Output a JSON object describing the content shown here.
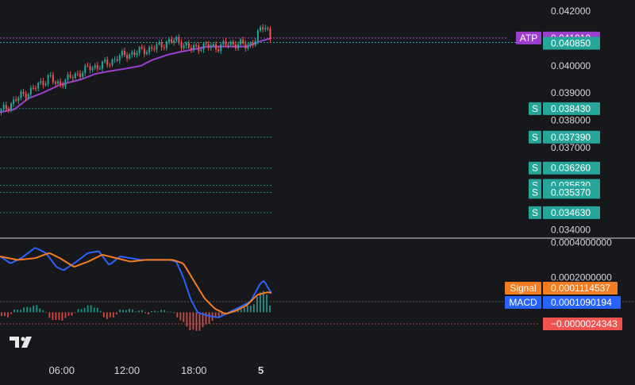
{
  "chart_data": [
    {
      "type": "candlestick",
      "title": "",
      "ylim": [
        0.0337,
        0.0424
      ],
      "price_axis_ticks": [
        "0.042000",
        "0.040000",
        "0.039000",
        "0.038000",
        "0.037000",
        "0.034000"
      ],
      "price_axis_tick_values": [
        0.042,
        0.04,
        0.039,
        0.038,
        0.037,
        0.034
      ],
      "last_price": {
        "value": 0.04085,
        "label": "0.040850"
      },
      "atp": {
        "name": "ATP",
        "value": 0.04101,
        "label": "0.041010",
        "color": "#9c3fce"
      },
      "support_levels": [
        {
          "tag": "S",
          "value": 0.03843,
          "label": "0.038430"
        },
        {
          "tag": "S",
          "value": 0.03739,
          "label": "0.037390"
        },
        {
          "tag": "S",
          "value": 0.03626,
          "label": "0.036260"
        },
        {
          "tag": "S",
          "value": 0.03563,
          "label": "0.035630"
        },
        {
          "tag": "S",
          "value": 0.03537,
          "label": "0.035370"
        },
        {
          "tag": "S",
          "value": 0.03463,
          "label": "0.034630"
        }
      ],
      "atp_line_steps": [
        [
          0,
          0.0383
        ],
        [
          8,
          0.0384
        ],
        [
          16,
          0.0388
        ],
        [
          24,
          0.039
        ],
        [
          34,
          0.0393
        ],
        [
          46,
          0.0395
        ],
        [
          54,
          0.0397
        ],
        [
          62,
          0.0398
        ],
        [
          72,
          0.0399
        ],
        [
          80,
          0.04
        ],
        [
          86,
          0.0402
        ],
        [
          95,
          0.0404
        ],
        [
          102,
          0.0405
        ],
        [
          110,
          0.0406
        ],
        [
          118,
          0.0407
        ],
        [
          130,
          0.0407
        ],
        [
          140,
          0.0407
        ],
        [
          144,
          0.0408
        ],
        [
          148,
          0.0409
        ],
        [
          154,
          0.04101
        ]
      ],
      "price_path": [
        [
          0,
          0.0383
        ],
        [
          6,
          0.0386
        ],
        [
          12,
          0.0389
        ],
        [
          18,
          0.0391
        ],
        [
          24,
          0.0394
        ],
        [
          28,
          0.0396
        ],
        [
          32,
          0.0393
        ],
        [
          38,
          0.0395
        ],
        [
          44,
          0.0397
        ],
        [
          50,
          0.0399
        ],
        [
          56,
          0.04
        ],
        [
          62,
          0.0401
        ],
        [
          66,
          0.0403
        ],
        [
          72,
          0.0404
        ],
        [
          78,
          0.0405
        ],
        [
          84,
          0.0406
        ],
        [
          90,
          0.0407
        ],
        [
          96,
          0.0409
        ],
        [
          100,
          0.0409
        ],
        [
          104,
          0.0408
        ],
        [
          108,
          0.0406
        ],
        [
          112,
          0.0407
        ],
        [
          118,
          0.0407
        ],
        [
          124,
          0.0407
        ],
        [
          130,
          0.0408
        ],
        [
          136,
          0.0408
        ],
        [
          140,
          0.0407
        ],
        [
          144,
          0.0409
        ],
        [
          148,
          0.0413
        ],
        [
          150,
          0.0415
        ],
        [
          152,
          0.0413
        ],
        [
          154,
          0.04085
        ]
      ],
      "colors": {
        "up": "#26a69a",
        "down": "#ef5350",
        "last_price": "#26a69a",
        "support": "#26a69a"
      }
    },
    {
      "type": "line",
      "name": "MACD panel",
      "ylim": [
        -0.00028,
        0.00042
      ],
      "axis_ticks": [
        "0.0004000000",
        "0.0002000000"
      ],
      "axis_tick_values": [
        0.0004,
        0.0002
      ],
      "series": [
        {
          "name": "Signal",
          "value": 0.0001114537,
          "label": "0.0001114537",
          "color": "#f57c20",
          "values": [
            [
              0,
              0.00032
            ],
            [
              10,
              0.0003
            ],
            [
              20,
              0.00031
            ],
            [
              28,
              0.00034
            ],
            [
              34,
              0.00031
            ],
            [
              42,
              0.00026
            ],
            [
              50,
              0.00029
            ],
            [
              58,
              0.00033
            ],
            [
              66,
              0.00031
            ],
            [
              74,
              0.00029
            ],
            [
              82,
              0.0003
            ],
            [
              90,
              0.0003
            ],
            [
              98,
              0.0003
            ],
            [
              104,
              0.00028
            ],
            [
              110,
              0.00018
            ],
            [
              116,
              8e-05
            ],
            [
              122,
              2e-05
            ],
            [
              128,
              -1e-05
            ],
            [
              134,
              1e-05
            ],
            [
              140,
              4e-05
            ],
            [
              146,
              0.0001
            ],
            [
              152,
              0.000115
            ],
            [
              154,
              0.0001114537
            ]
          ]
        },
        {
          "name": "MACD",
          "value": 0.0001090194,
          "label": "0.0001090194",
          "color": "#2962ff",
          "values": [
            [
              0,
              0.00032
            ],
            [
              6,
              0.00028
            ],
            [
              12,
              0.00031
            ],
            [
              20,
              0.00037
            ],
            [
              26,
              0.00034
            ],
            [
              32,
              0.00026
            ],
            [
              36,
              0.00024
            ],
            [
              42,
              0.00028
            ],
            [
              50,
              0.00034
            ],
            [
              56,
              0.00035
            ],
            [
              62,
              0.00027
            ],
            [
              68,
              0.00032
            ],
            [
              74,
              0.00031
            ],
            [
              80,
              0.0003
            ],
            [
              88,
              0.0003
            ],
            [
              96,
              0.0003
            ],
            [
              100,
              0.00029
            ],
            [
              104,
              0.0002
            ],
            [
              108,
              8e-05
            ],
            [
              112,
              0.0
            ],
            [
              118,
              -2e-05
            ],
            [
              124,
              -3e-05
            ],
            [
              130,
              0.0
            ],
            [
              136,
              3e-05
            ],
            [
              142,
              6e-05
            ],
            [
              148,
              0.00017
            ],
            [
              150,
              0.00018
            ],
            [
              152,
              0.00014
            ],
            [
              154,
              0.0001090194
            ]
          ]
        }
      ],
      "histogram": {
        "value": -2.4343e-06,
        "label": "−0.0000024343",
        "color": "#ef5350",
        "values": [
          [
            0,
            -2e-05
          ],
          [
            4,
            -3e-05
          ],
          [
            8,
            1e-05
          ],
          [
            12,
            2e-05
          ],
          [
            16,
            3e-05
          ],
          [
            20,
            4e-05
          ],
          [
            24,
            2e-05
          ],
          [
            28,
            -3e-05
          ],
          [
            32,
            -5e-05
          ],
          [
            36,
            -4e-05
          ],
          [
            40,
            -2e-05
          ],
          [
            44,
            1e-05
          ],
          [
            48,
            3e-05
          ],
          [
            52,
            4e-05
          ],
          [
            56,
            2e-05
          ],
          [
            60,
            -4e-05
          ],
          [
            64,
            -3e-05
          ],
          [
            68,
            1e-05
          ],
          [
            72,
            2e-05
          ],
          [
            76,
            1e-05
          ],
          [
            80,
            1e-05
          ],
          [
            84,
            -1e-05
          ],
          [
            88,
            1e-05
          ],
          [
            92,
            1e-05
          ],
          [
            96,
            1e-05
          ],
          [
            100,
            -2e-05
          ],
          [
            104,
            -6e-05
          ],
          [
            108,
            -0.0001
          ],
          [
            112,
            -0.00011
          ],
          [
            116,
            -8e-05
          ],
          [
            120,
            -5e-05
          ],
          [
            124,
            -3e-05
          ],
          [
            128,
            -1e-05
          ],
          [
            132,
            1e-05
          ],
          [
            136,
            2e-05
          ],
          [
            140,
            3e-05
          ],
          [
            144,
            5e-05
          ],
          [
            148,
            0.00012
          ],
          [
            150,
            0.00013
          ],
          [
            152,
            8e-05
          ],
          [
            154,
            -2.4343e-06
          ]
        ]
      }
    }
  ],
  "time_axis": {
    "labels": [
      "06:00",
      "12:00",
      "18:00",
      "5"
    ],
    "positions": [
      35,
      72,
      110,
      148
    ],
    "bold": [
      false,
      false,
      false,
      true
    ]
  },
  "time_extent": [
    0,
    154
  ]
}
